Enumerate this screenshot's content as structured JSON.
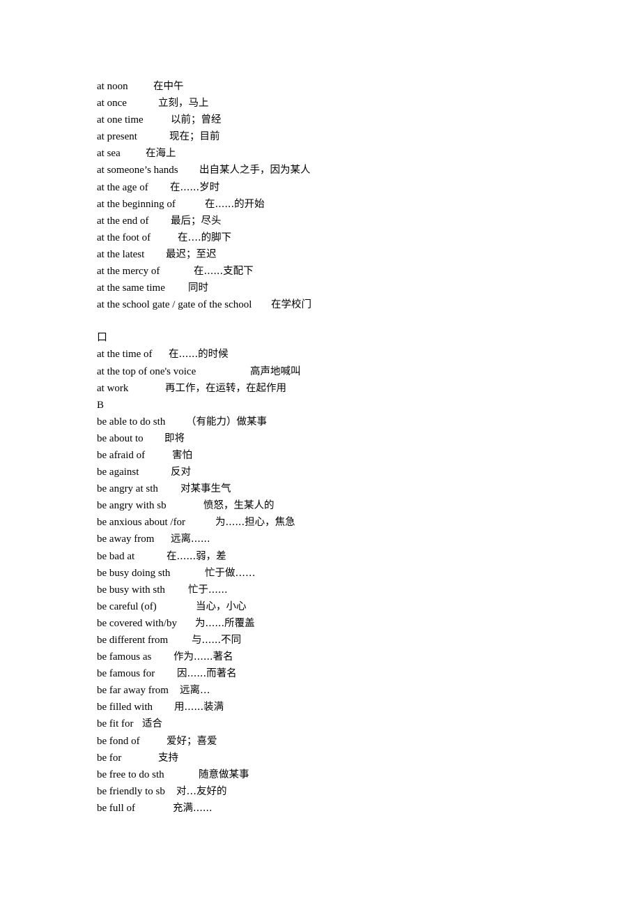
{
  "document": {
    "entries": [
      {
        "en": "at noon",
        "zh": "在中午"
      },
      {
        "en": "at once",
        "zh": "立刻，马上"
      },
      {
        "en": "at one time",
        "zh": "以前；曾经"
      },
      {
        "en": "at present",
        "zh": "现在；目前"
      },
      {
        "en": "at sea",
        "zh": "在海上"
      },
      {
        "en": "at someone’s hands",
        "zh": "出自某人之手，因为某人"
      },
      {
        "en": "at the age of",
        "zh": "在......岁时"
      },
      {
        "en": "at the beginning of",
        "zh": "在......的开始"
      },
      {
        "en": "at the end of",
        "zh": "最后；尽头"
      },
      {
        "en": "at the foot of",
        "zh": "在….的脚下"
      },
      {
        "en": "at the latest",
        "zh": "最迟；至迟"
      },
      {
        "en": "at the mercy of",
        "zh": "在......支配下"
      },
      {
        "en": "at the same time",
        "zh": "同时"
      },
      {
        "en": "at the school gate / gate of the school",
        "zh": "在学校门"
      },
      {
        "en": "",
        "zh": ""
      },
      {
        "en": "口",
        "zh": ""
      },
      {
        "en": "at the time of",
        "zh": "在......的时候"
      },
      {
        "en": "at the top of one's voice",
        "zh": "高声地喊叫"
      },
      {
        "en": "at work",
        "zh": "再工作，在运转，在起作用"
      },
      {
        "en": "B",
        "zh": ""
      },
      {
        "en": "be able to do sth",
        "zh": "（有能力）做某事"
      },
      {
        "en": "be about to",
        "zh": "即将"
      },
      {
        "en": "be afraid of",
        "zh": "害怕"
      },
      {
        "en": "be against",
        "zh": "反对"
      },
      {
        "en": "be angry at sth",
        "zh": "对某事生气"
      },
      {
        "en": "be angry with    sb",
        "zh": "愤怒，生某人的"
      },
      {
        "en": "be anxious about /for",
        "zh": "为......担心，焦急"
      },
      {
        "en": "be away from",
        "zh": "远离......"
      },
      {
        "en": "be bad at",
        "zh": "在......弱，差"
      },
      {
        "en": "be busy doing sth",
        "zh": "忙于做……"
      },
      {
        "en": "be busy with sth",
        "zh": "忙于......"
      },
      {
        "en": "be careful (of)",
        "zh": "当心，小心"
      },
      {
        "en": "be covered with/by",
        "zh": "为......所覆盖"
      },
      {
        "en": "be different from",
        "zh": "与......不同"
      },
      {
        "en": "be famous as",
        "zh": "作为......著名"
      },
      {
        "en": "be famous for",
        "zh": "因......而著名"
      },
      {
        "en": "be far away from",
        "zh": "远离…"
      },
      {
        "en": "be filled with",
        "zh": "用......装满"
      },
      {
        "en": "be fit for",
        "zh": "适合"
      },
      {
        "en": "be fond of",
        "zh": "爱好；喜爱"
      },
      {
        "en": "be for",
        "zh": "支持"
      },
      {
        "en": "be free to do sth",
        "zh": "随意做某事"
      },
      {
        "en": "be friendly to sb",
        "zh": "对…友好的"
      },
      {
        "en": "be full of",
        "zh": "充满......"
      }
    ]
  }
}
